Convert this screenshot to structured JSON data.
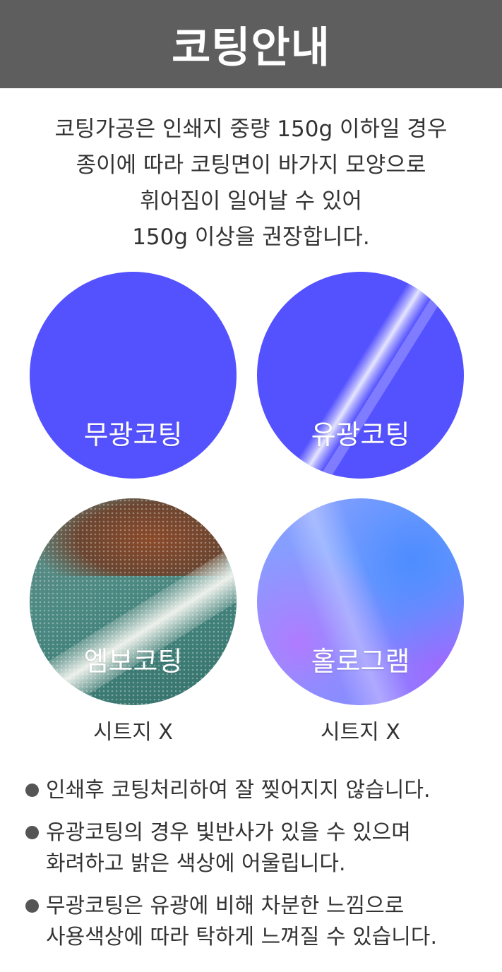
{
  "header": {
    "title": "코팅안내"
  },
  "intro": {
    "lines": [
      "코팅가공은 인쇄지 중량 150g 이하일 경우",
      "종이에 따라 코팅면이 바가지 모양으로",
      "휘어짐이 일어날 수 있어",
      "150g 이상을 권장합니다."
    ]
  },
  "samples": [
    {
      "label": "무광코팅",
      "color": "#5451ff"
    },
    {
      "label": "유광코팅",
      "color": "#5451ff"
    },
    {
      "label": "엠보코팅",
      "note": "시트지 X"
    },
    {
      "label": "홀로그램",
      "note": "시트지 X"
    }
  ],
  "bullets": [
    {
      "lines": [
        "인쇄후 코팅처리하여 잘 찢어지지 않습니다."
      ]
    },
    {
      "lines": [
        "유광코팅의 경우 빛반사가 있을 수 있으며",
        "화려하고 밝은 색상에 어울립니다."
      ]
    },
    {
      "lines": [
        "무광코팅은 유광에 비해 차분한 느낌으로",
        "사용색상에 따라 탁하게 느껴질 수 있습니다."
      ]
    }
  ]
}
